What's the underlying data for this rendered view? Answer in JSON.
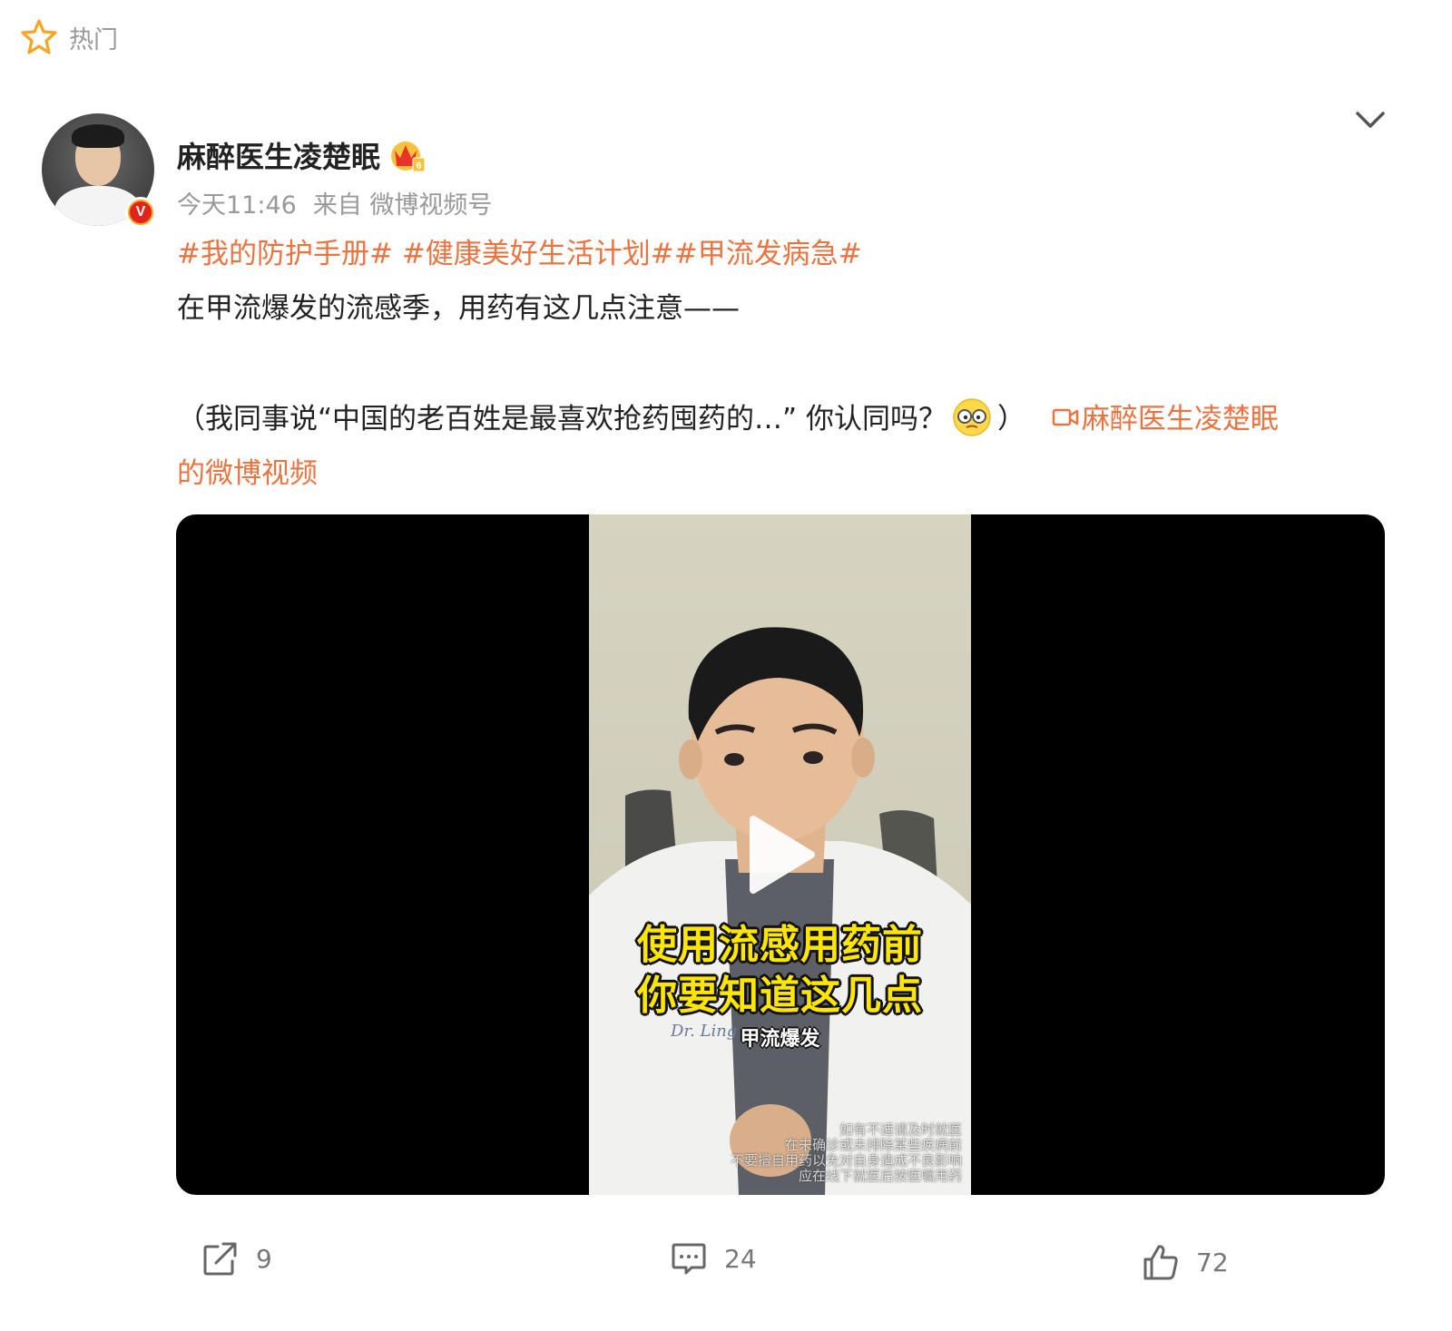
{
  "header": {
    "label": "热门",
    "icon": "star-outline-icon",
    "icon_color": "#f5a623"
  },
  "post": {
    "author": {
      "name": "麻醉医生凌楚眠",
      "verified_badge_icon": "verified-v-icon",
      "member_icon": "crown-icon"
    },
    "meta": {
      "time": "今天11:46",
      "source": "来自 微博视频号"
    },
    "topics": [
      "#我的防护手册#",
      "#健康美好生活计划#",
      "#甲流发病急#"
    ],
    "text_line1": "在甲流爆发的流感季，用药有这几点注意——",
    "text_line2_prefix": "（我同事说“中国的老百姓是最喜欢抢药囤药的…” 你认同吗？",
    "text_line2_emoji": "face-with-glasses-emoji",
    "text_line2_suffix": "）",
    "video_link_part1": "麻醉医生凌楚眠",
    "video_link_part2": "的微博视频",
    "accent_color": "#eb7340"
  },
  "video": {
    "caption_line1": "使用流感用药前",
    "caption_line2": "你要知道这几点",
    "caption_line3": "甲流爆发",
    "disclaimer": [
      "如有不适请及时就医",
      "在未确诊或未排除某些疾病前",
      "不要擅自用药以免对自身造成不良影响",
      "应在线下就医后按医嘱用药"
    ],
    "play_icon": "play-icon"
  },
  "actions": {
    "repost_count": "9",
    "comment_count": "24",
    "like_count": "72"
  }
}
